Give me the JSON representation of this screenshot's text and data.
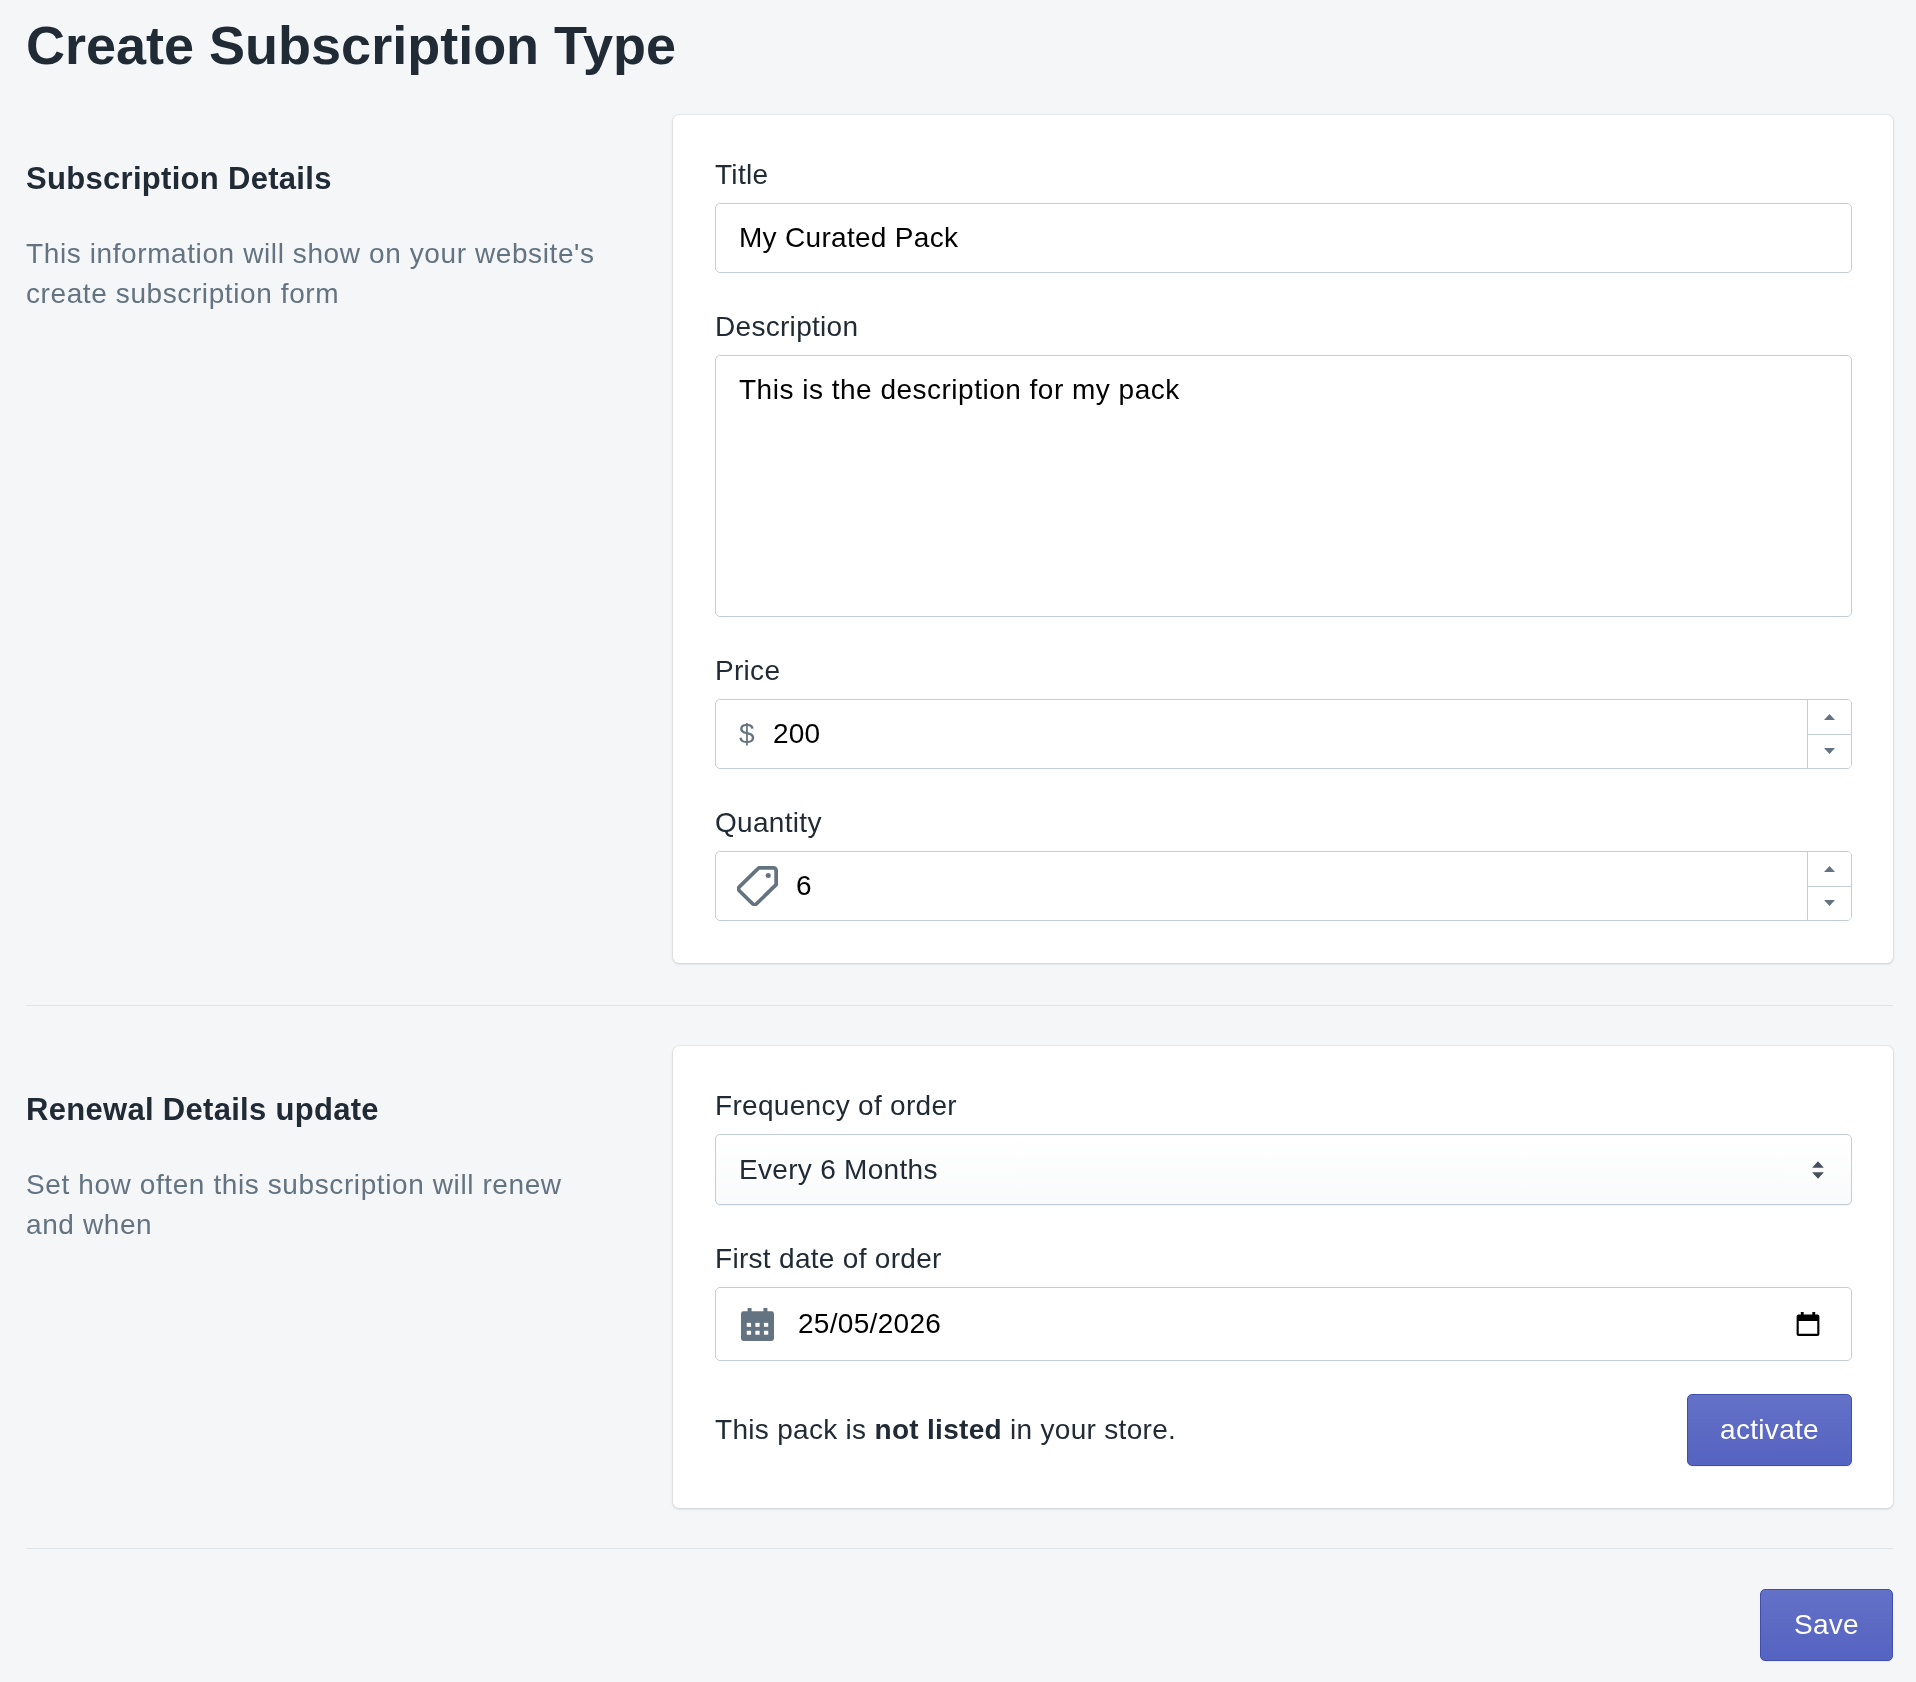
{
  "page": {
    "title": "Create Subscription Type"
  },
  "sections": [
    {
      "heading": "Subscription Details",
      "description": "This information will show on your website's create subscription form",
      "fields": [
        {
          "kind": "text",
          "label": "Title",
          "value": "My Curated Pack"
        },
        {
          "kind": "textarea",
          "label": "Description",
          "value": "This is the description for my pack"
        },
        {
          "kind": "price",
          "label": "Price",
          "prefix": "$",
          "value": "200"
        },
        {
          "kind": "quantity",
          "label": "Quantity",
          "value": "6"
        }
      ]
    },
    {
      "heading": "Renewal Details update",
      "description": "Set how often this subscription will renew and when",
      "fields": [
        {
          "kind": "select",
          "label": "Frequency of order",
          "value": "Every 6 Months"
        },
        {
          "kind": "date",
          "label": "First date of order",
          "value": "25/05/2026"
        }
      ],
      "status": {
        "text": "This pack is **not listed** in your store.",
        "button": "activate"
      }
    }
  ],
  "save_button": "Save"
}
